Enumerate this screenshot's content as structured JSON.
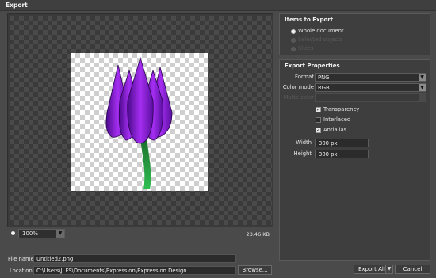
{
  "window": {
    "title": "Export"
  },
  "preview": {
    "zoom": "100%",
    "file_size": "23.46 KB",
    "image_icon": "purple-tulip"
  },
  "items_to_export": {
    "title": "Items to Export",
    "options": [
      {
        "label": "Whole document",
        "selected": true,
        "enabled": true
      },
      {
        "label": "Selected objects",
        "selected": false,
        "enabled": false
      },
      {
        "label": "Slices",
        "selected": false,
        "enabled": false
      }
    ]
  },
  "export_properties": {
    "title": "Export Properties",
    "format_label": "Format",
    "format_value": "PNG",
    "color_mode_label": "Color mode",
    "color_mode_value": "RGB",
    "matte_label": "Matte color",
    "transparency_label": "Transparency",
    "transparency": true,
    "interlaced_label": "Interlaced",
    "interlaced": false,
    "antialias_label": "Antialias",
    "antialias": true,
    "width_label": "Width",
    "width_value": "300 px",
    "height_label": "Height",
    "height_value": "300 px"
  },
  "footer": {
    "file_name_label": "File name",
    "file_name_value": "Untitled2.png",
    "location_label": "Location",
    "location_value": "C:\\Users\\JLFS\\Documents\\Expression\\Expression Design",
    "browse_label": "Browse...",
    "export_all_label": "Export All",
    "cancel_label": "Cancel"
  },
  "colors": {
    "background": "#4a4a4a",
    "panel": "#3e3e3e",
    "tulip_petal": "#8a1bd6",
    "tulip_stem": "#1f9e3c"
  }
}
